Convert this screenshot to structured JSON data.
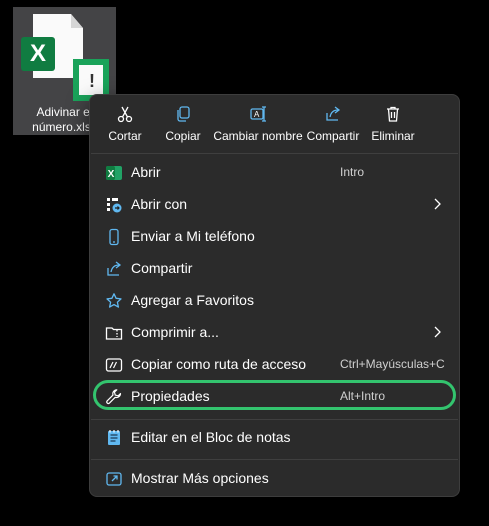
{
  "file": {
    "name_line1": "Adivinar el",
    "name_line2": "número.xlsx",
    "app_letter": "X",
    "badge_mark": "!"
  },
  "actions": [
    {
      "label": "Cortar",
      "icon": "scissors-icon"
    },
    {
      "label": "Copiar",
      "icon": "copy-icon"
    },
    {
      "label": "Cambiar nombre",
      "icon": "rename-icon"
    },
    {
      "label": "Compartir",
      "icon": "share-icon"
    },
    {
      "label": "Eliminar",
      "icon": "trash-icon"
    }
  ],
  "menu": {
    "items": [
      {
        "label": "Abrir",
        "shortcut": "Intro",
        "icon": "excel-icon"
      },
      {
        "label": "Abrir con",
        "shortcut": "",
        "icon": "open-with-icon",
        "submenu": true
      },
      {
        "label": "Enviar a Mi teléfono",
        "shortcut": "",
        "icon": "phone-icon"
      },
      {
        "label": "Compartir",
        "shortcut": "",
        "icon": "share-icon"
      },
      {
        "label": "Agregar a Favoritos",
        "shortcut": "",
        "icon": "star-icon"
      },
      {
        "label": "Comprimir a...",
        "shortcut": "",
        "icon": "folder-zip-icon",
        "submenu": true
      },
      {
        "label": "Copiar como ruta de acceso",
        "shortcut": "Ctrl+Mayúsculas+C",
        "icon": "copy-path-icon"
      },
      {
        "label": "Propiedades",
        "shortcut": "Alt+Intro",
        "icon": "wrench-icon",
        "highlighted": true
      },
      {
        "label": "Editar en el Bloc de notas",
        "shortcut": "",
        "icon": "notepad-icon"
      },
      {
        "label": "Mostrar Más opciones",
        "shortcut": "",
        "icon": "more-options-icon"
      }
    ]
  },
  "colors": {
    "menu_bg": "#2b2b2b",
    "highlight": "#33c46e",
    "excel_green": "#107c41",
    "icon_blue": "#60b8f0"
  }
}
